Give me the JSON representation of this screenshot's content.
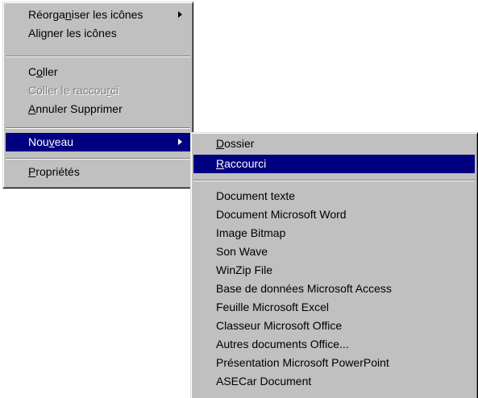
{
  "context_menu": {
    "items": [
      {
        "pre": "Réorga",
        "acc": "n",
        "post": "iser les icônes"
      },
      {
        "pre": "Ali",
        "acc": "g",
        "post": "ner les icônes"
      },
      {
        "pre": "C",
        "acc": "o",
        "post": "ller"
      },
      {
        "pre": "Coller le raccou",
        "acc": "r",
        "post": "ci"
      },
      {
        "pre": "",
        "acc": "A",
        "post": "nnuler Supprimer"
      },
      {
        "pre": "Nou",
        "acc": "v",
        "post": "eau"
      },
      {
        "pre": "",
        "acc": "P",
        "post": "ropriétés"
      }
    ]
  },
  "submenu_nouveau": {
    "items": [
      {
        "pre": "",
        "acc": "D",
        "post": "ossier"
      },
      {
        "pre": "",
        "acc": "R",
        "post": "accourci"
      },
      {
        "label": "Document texte"
      },
      {
        "label": "Document Microsoft Word"
      },
      {
        "label": "Image Bitmap"
      },
      {
        "label": "Son Wave"
      },
      {
        "label": "WinZip File"
      },
      {
        "label": "Base de données Microsoft Access"
      },
      {
        "label": "Feuille Microsoft Excel"
      },
      {
        "label": "Classeur Microsoft Office"
      },
      {
        "label": "Autres documents Office..."
      },
      {
        "label": "Présentation Microsoft PowerPoint"
      },
      {
        "label": "ASECar Document"
      }
    ]
  },
  "colors": {
    "menu_background": "#c0c0c0",
    "highlight": "#000080",
    "highlight_text": "#ffffff",
    "disabled_text": "#808080"
  }
}
